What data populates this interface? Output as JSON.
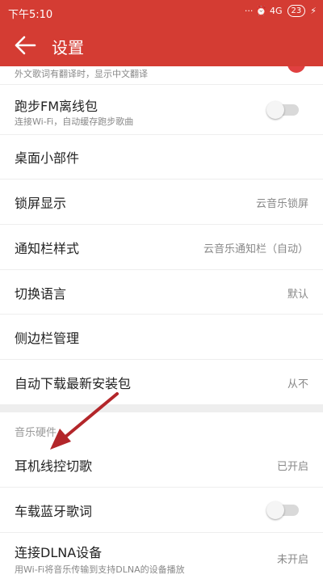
{
  "status_bar": {
    "time": "下午5:10",
    "indicators": "··· ⏰ 4G",
    "battery": "23",
    "icons": [
      "more-dots-icon",
      "alarm-icon",
      "signal-icon",
      "battery-icon",
      "charging-icon"
    ]
  },
  "app_bar": {
    "title": "设置",
    "back_icon": "back-arrow-icon"
  },
  "partial_row": {
    "subtitle": "外文歌词有翻译时，显示中文翻译",
    "toggle_on": true
  },
  "rows": [
    {
      "label": "跑步FM离线包",
      "subtitle": "连接Wi-Fi，自动缓存跑步歌曲",
      "toggle_on": false
    },
    {
      "label": "桌面小部件"
    },
    {
      "label": "锁屏显示",
      "value": "云音乐锁屏"
    },
    {
      "label": "通知栏样式",
      "value": "云音乐通知栏（自动）"
    },
    {
      "label": "切换语言",
      "value": "默认"
    },
    {
      "label": "侧边栏管理"
    },
    {
      "label": "自动下载最新安装包",
      "value": "从不"
    }
  ],
  "section": {
    "header": "音乐硬件"
  },
  "hardware_rows": [
    {
      "label": "耳机线控切歌",
      "value": "已开启"
    },
    {
      "label": "车载蓝牙歌词",
      "toggle_on": false
    },
    {
      "label": "连接DLNA设备",
      "subtitle": "用Wi-Fi将音乐传输到支持DLNA的设备播放",
      "value": "未开启"
    }
  ],
  "colors": {
    "brand_red": "#d43c33",
    "annotation_arrow": "#b3262a"
  }
}
